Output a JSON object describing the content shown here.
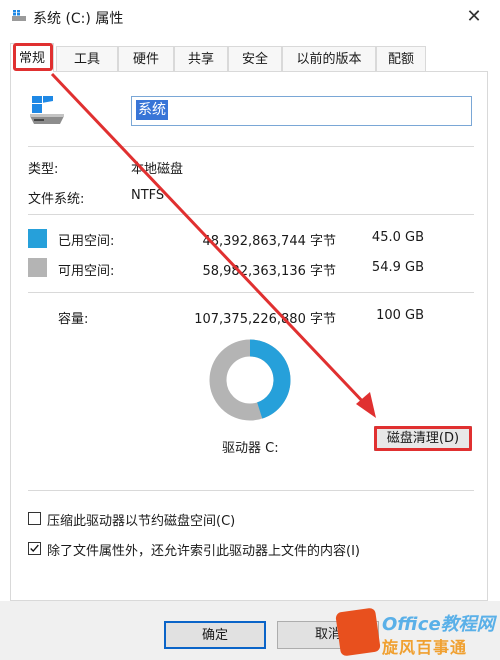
{
  "window": {
    "title": "系统 (C:) 属性",
    "close_glyph": "✕"
  },
  "tabs": [
    "常规",
    "工具",
    "硬件",
    "共享",
    "安全",
    "以前的版本",
    "配额"
  ],
  "general": {
    "name_value": "系统",
    "type_label": "类型:",
    "type_value": "本地磁盘",
    "fs_label": "文件系统:",
    "fs_value": "NTFS",
    "used_label": "已用空间:",
    "used_bytes": "48,392,863,744 字节",
    "used_gb": "45.0 GB",
    "free_label": "可用空间:",
    "free_bytes": "58,982,363,136 字节",
    "free_gb": "54.9 GB",
    "capacity_label": "容量:",
    "capacity_bytes": "107,375,226,880 字节",
    "capacity_gb": "100 GB",
    "drive_label": "驱动器 C:",
    "cleanup_button": "磁盘清理(D)",
    "used_fraction": 0.45,
    "used_color": "#26a0da",
    "free_color": "#b4b4b4"
  },
  "options": {
    "compress_label": "压缩此驱动器以节约磁盘空间(C)",
    "compress_checked": false,
    "index_label": "除了文件属性外，还允许索引此驱动器上文件的内容(I)",
    "index_checked": true
  },
  "footer": {
    "ok_button": "确定",
    "cancel_button": "取消"
  },
  "watermark": {
    "text1": "Office教程网",
    "text2": "旋风百事通"
  },
  "annotation_color": "#e03030"
}
